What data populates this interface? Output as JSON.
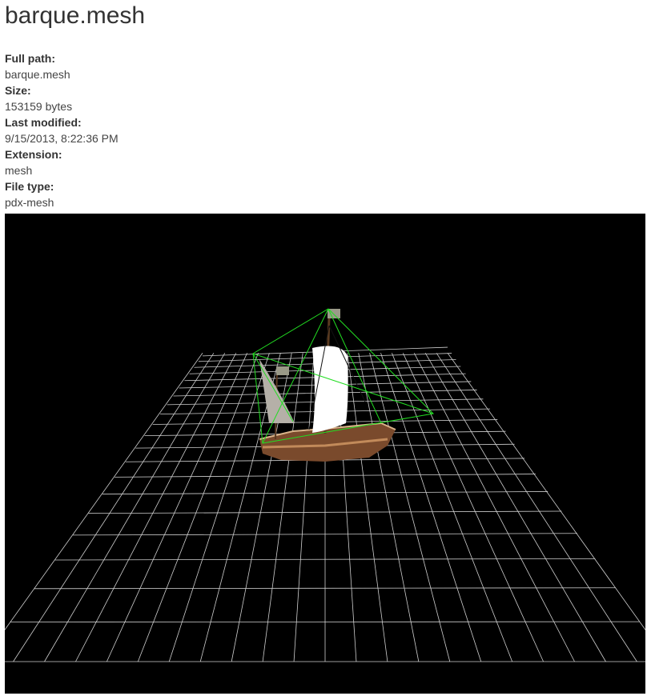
{
  "file": {
    "title": "barque.mesh",
    "fields": [
      {
        "label": "Full path:",
        "value": "barque.mesh"
      },
      {
        "label": "Size:",
        "value": "153159 bytes"
      },
      {
        "label": "Last modified:",
        "value": "9/15/2013, 8:22:36 PM"
      },
      {
        "label": "Extension:",
        "value": "mesh"
      },
      {
        "label": "File type:",
        "value": "pdx-mesh"
      }
    ]
  },
  "viewer": {
    "background": "#000000",
    "grid_color": "#d0d0d0",
    "bounding_color": "#22dd22",
    "sail_color": "#ffffff",
    "hull_color": "#8a5a3a"
  }
}
